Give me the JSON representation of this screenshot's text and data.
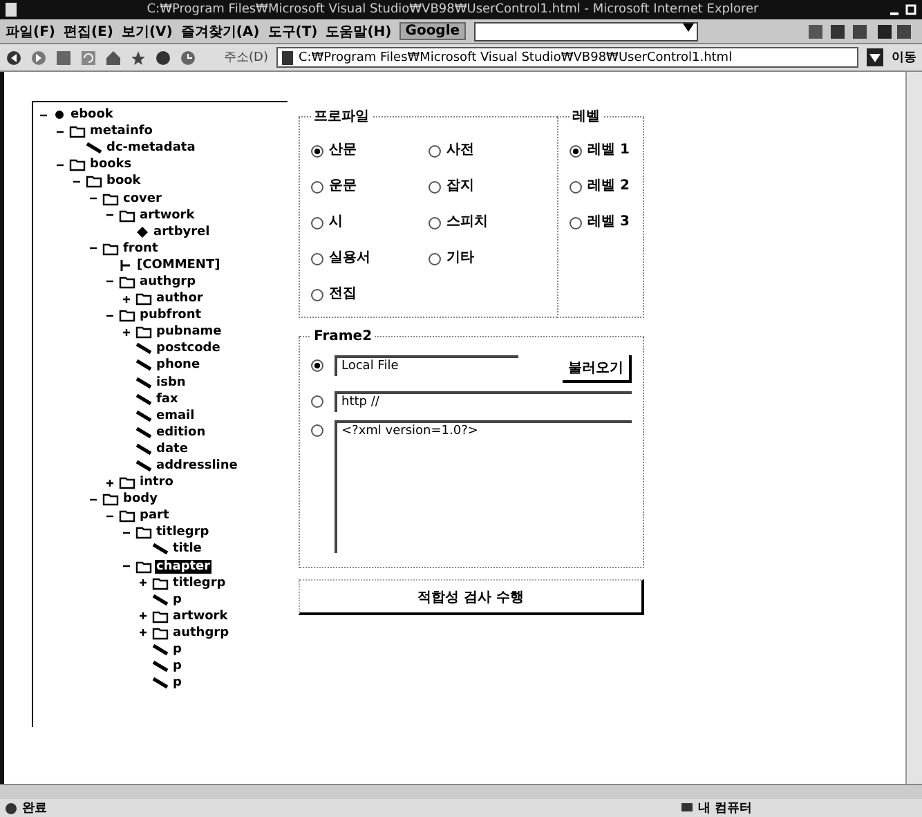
{
  "window": {
    "title": "C:₩Program Files₩Microsoft Visual Studio₩VB98₩UserControl1.html - Microsoft Internet Explorer"
  },
  "menu": [
    "파일(F)",
    "편집(E)",
    "보기(V)",
    "즐겨찾기(A)",
    "도구(T)",
    "도움말(H)"
  ],
  "google_toolbar": {
    "label": "Google"
  },
  "address_bar": {
    "label": "주소(D)",
    "value": "C:₩Program Files₩Microsoft Visual Studio₩VB98₩UserControl1.html",
    "go": "이동"
  },
  "tree": [
    {
      "label": "ebook",
      "kind": "root",
      "selected": false,
      "expanded": true,
      "children": [
        {
          "label": "metainfo",
          "kind": "element",
          "selected": false,
          "expanded": true,
          "children": [
            {
              "label": "dc-metadata",
              "kind": "leaf",
              "selected": false
            }
          ]
        },
        {
          "label": "books",
          "kind": "element",
          "selected": false,
          "expanded": true,
          "children": [
            {
              "label": "book",
              "kind": "element",
              "selected": false,
              "expanded": true,
              "children": [
                {
                  "label": "cover",
                  "kind": "element",
                  "selected": false,
                  "expanded": true,
                  "children": [
                    {
                      "label": "artwork",
                      "kind": "element",
                      "selected": false,
                      "expanded": true,
                      "children": [
                        {
                          "label": "artbyrel",
                          "kind": "attribute",
                          "selected": false
                        }
                      ]
                    }
                  ]
                },
                {
                  "label": "front",
                  "kind": "element",
                  "selected": false,
                  "expanded": true,
                  "children": [
                    {
                      "label": "[COMMENT]",
                      "kind": "comment",
                      "selected": false
                    },
                    {
                      "label": "authgrp",
                      "kind": "element",
                      "selected": false,
                      "expanded": true,
                      "children": [
                        {
                          "label": "author",
                          "kind": "element",
                          "selected": false,
                          "expanded": false
                        }
                      ]
                    },
                    {
                      "label": "pubfront",
                      "kind": "element",
                      "selected": false,
                      "expanded": true,
                      "children": [
                        {
                          "label": "pubname",
                          "kind": "element",
                          "selected": false,
                          "expanded": false
                        },
                        {
                          "label": "postcode",
                          "kind": "leaf",
                          "selected": false
                        },
                        {
                          "label": "phone",
                          "kind": "leaf",
                          "selected": false
                        },
                        {
                          "label": "isbn",
                          "kind": "leaf",
                          "selected": false
                        },
                        {
                          "label": "fax",
                          "kind": "leaf",
                          "selected": false
                        },
                        {
                          "label": "email",
                          "kind": "leaf",
                          "selected": false
                        },
                        {
                          "label": "edition",
                          "kind": "leaf",
                          "selected": false
                        },
                        {
                          "label": "date",
                          "kind": "leaf",
                          "selected": false
                        },
                        {
                          "label": "addressline",
                          "kind": "leaf",
                          "selected": false
                        }
                      ]
                    },
                    {
                      "label": "intro",
                      "kind": "element",
                      "selected": false,
                      "expanded": false
                    }
                  ]
                },
                {
                  "label": "body",
                  "kind": "element",
                  "selected": false,
                  "expanded": true,
                  "children": [
                    {
                      "label": "part",
                      "kind": "element",
                      "selected": false,
                      "expanded": true,
                      "children": [
                        {
                          "label": "titlegrp",
                          "kind": "element",
                          "selected": false,
                          "expanded": true,
                          "children": [
                            {
                              "label": "title",
                              "kind": "leaf",
                              "selected": false
                            }
                          ]
                        },
                        {
                          "label": "chapter",
                          "kind": "element",
                          "selected": true,
                          "expanded": true,
                          "children": [
                            {
                              "label": "titlegrp",
                              "kind": "element",
                              "selected": false,
                              "expanded": false
                            },
                            {
                              "label": "p",
                              "kind": "leaf",
                              "selected": false
                            },
                            {
                              "label": "artwork",
                              "kind": "element",
                              "selected": false,
                              "expanded": false
                            },
                            {
                              "label": "authgrp",
                              "kind": "element",
                              "selected": false,
                              "expanded": false
                            },
                            {
                              "label": "p",
                              "kind": "leaf",
                              "selected": false
                            },
                            {
                              "label": "p",
                              "kind": "leaf",
                              "selected": false
                            },
                            {
                              "label": "p",
                              "kind": "leaf",
                              "selected": false
                            }
                          ]
                        }
                      ]
                    }
                  ]
                }
              ]
            }
          ]
        }
      ]
    }
  ],
  "profile_frame": {
    "title": "프로파일",
    "options": [
      {
        "label": "산문",
        "selected": true
      },
      {
        "label": "사전",
        "selected": false
      },
      {
        "label": "운문",
        "selected": false
      },
      {
        "label": "잡지",
        "selected": false
      },
      {
        "label": "시",
        "selected": false
      },
      {
        "label": "스피치",
        "selected": false
      },
      {
        "label": "실용서",
        "selected": false
      },
      {
        "label": "기타",
        "selected": false
      },
      {
        "label": "전집",
        "selected": false
      }
    ]
  },
  "level_frame": {
    "title": "레벨",
    "options": [
      {
        "label": "레벨 1",
        "selected": true
      },
      {
        "label": "레벨 2",
        "selected": false
      },
      {
        "label": "레벨 3",
        "selected": false
      }
    ]
  },
  "frame2": {
    "title": "Frame2",
    "sources": [
      {
        "kind": "file",
        "value": "Local File",
        "selected": true,
        "button": "불러오기"
      },
      {
        "kind": "url",
        "value": "http //",
        "selected": false
      },
      {
        "kind": "text",
        "value": "<?xml version=1.0?>",
        "selected": false
      }
    ]
  },
  "validate_button": "적합성 검사 수행",
  "status_bar": {
    "status": "완료",
    "zone": "내 컴퓨터"
  }
}
